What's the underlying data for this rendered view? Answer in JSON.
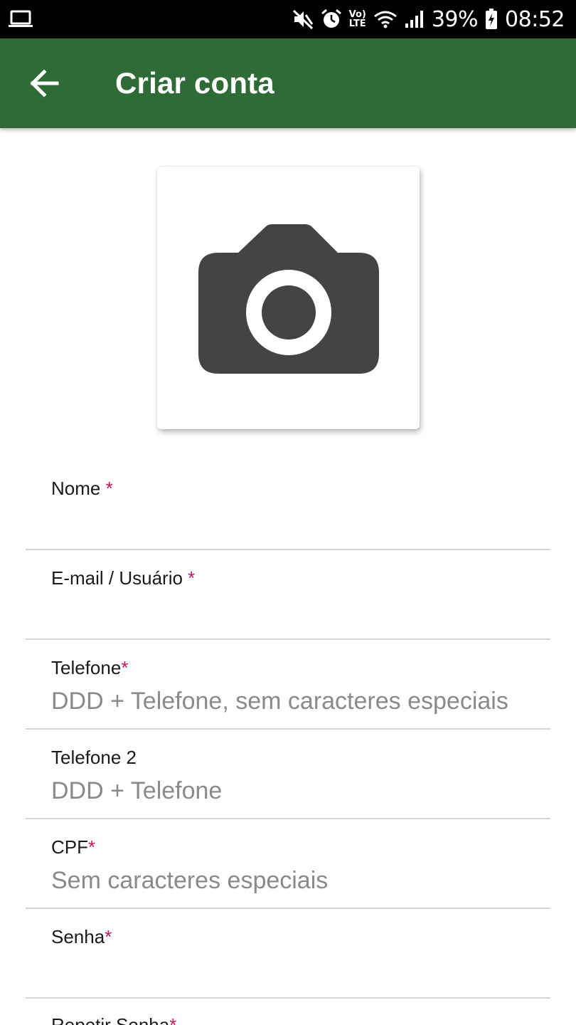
{
  "status_bar": {
    "battery": "39%",
    "time": "08:52",
    "volte_top": "Vo)",
    "volte_bottom": "LTE",
    "icons": [
      "laptop-icon",
      "mute-icon",
      "alarm-icon",
      "volte-icon",
      "wifi-icon",
      "signal-icon",
      "battery-charging-icon"
    ]
  },
  "app_bar": {
    "title": "Criar conta",
    "back_icon": "arrow-back-icon",
    "color": "#2e6b36"
  },
  "photo": {
    "icon": "camera-icon"
  },
  "form": {
    "required_mark": "*",
    "required_color": "#c2185b",
    "fields": [
      {
        "label": "Nome",
        "required": true,
        "placeholder": "",
        "value": ""
      },
      {
        "label": "E-mail / Usuário",
        "required": true,
        "placeholder": "",
        "value": ""
      },
      {
        "label": "Telefone",
        "required": true,
        "placeholder": "DDD + Telefone, sem caracteres especiais",
        "value": ""
      },
      {
        "label": "Telefone 2",
        "required": false,
        "placeholder": "DDD + Telefone",
        "value": ""
      },
      {
        "label": "CPF",
        "required": true,
        "placeholder": "Sem caracteres especiais",
        "value": ""
      },
      {
        "label": "Senha",
        "required": true,
        "placeholder": "",
        "value": ""
      },
      {
        "label": "Repetir Senha",
        "required": true,
        "placeholder": "",
        "value": ""
      }
    ]
  }
}
